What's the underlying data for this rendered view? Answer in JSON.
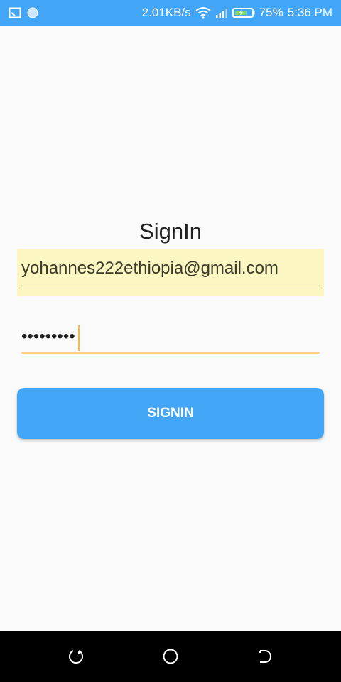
{
  "status_bar": {
    "network_speed": "2.01KB/s",
    "battery": "75%",
    "time": "5:36 PM",
    "icons": [
      "cast-icon",
      "notification-dot-icon",
      "wifi-icon",
      "signal-icon",
      "battery-charging-icon"
    ]
  },
  "form": {
    "title": "SignIn",
    "email_value": "yohannes222ethiopia@gmail.com",
    "password_value": "•••••••••",
    "submit_label": "SIGNIN"
  },
  "nav_bar": {
    "icons": [
      "recents-icon",
      "home-icon",
      "back-icon"
    ]
  },
  "colors": {
    "accent": "#42a5f5",
    "autofill_bg": "#fbf6c2",
    "focus_underline": "#fcd08a",
    "background": "#fafafa"
  }
}
